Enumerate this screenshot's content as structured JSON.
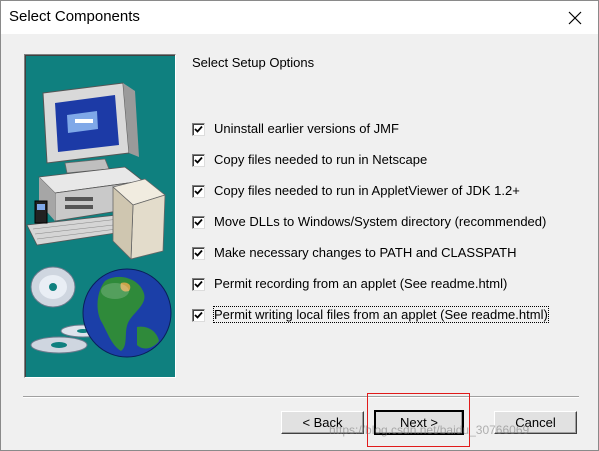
{
  "window": {
    "title": "Select Components"
  },
  "heading": "Select Setup Options",
  "options": [
    {
      "label": "Uninstall earlier versions of JMF",
      "checked": true
    },
    {
      "label": "Copy files needed to run in Netscape",
      "checked": true
    },
    {
      "label": "Copy files needed to run in AppletViewer of JDK 1.2+",
      "checked": true
    },
    {
      "label": "Move DLLs to Windows/System directory (recommended)",
      "checked": true
    },
    {
      "label": "Make necessary changes to PATH and CLASSPATH",
      "checked": true
    },
    {
      "label": "Permit recording from an applet (See readme.html)",
      "checked": true
    },
    {
      "label": "Permit writing local files from an applet (See readme.html)",
      "checked": true
    }
  ],
  "buttons": {
    "back": "< Back",
    "next": "Next >",
    "cancel": "Cancel"
  },
  "watermark": "https://blog.csdn.net/baidu_30766069",
  "colors": {
    "art_background": "#0f807f",
    "highlight_box": "#e11b1b"
  },
  "icons": {
    "close": "close-icon",
    "illustration": "computer-cd-globe-illustration"
  }
}
